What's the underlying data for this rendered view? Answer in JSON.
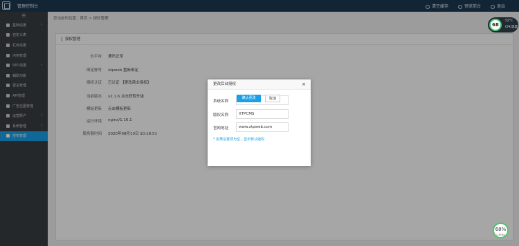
{
  "app": {
    "title": "管理控制台"
  },
  "topbar": {
    "links": [
      "清空缓存",
      "预览前台",
      "退出"
    ]
  },
  "sidebar": {
    "toggle": "☰",
    "items": [
      {
        "label": "基础设置",
        "arrow": true
      },
      {
        "label": "自定义表",
        "arrow": false
      },
      {
        "label": "栏目设置",
        "arrow": false
      },
      {
        "label": "内容管理",
        "arrow": false
      },
      {
        "label": "SEO设置",
        "arrow": true
      },
      {
        "label": "辅助功能",
        "arrow": false
      },
      {
        "label": "留言管理",
        "arrow": false
      },
      {
        "label": "API管理",
        "arrow": false
      },
      {
        "label": "广告位图管理",
        "arrow": false
      },
      {
        "label": "运营账户",
        "arrow": true
      },
      {
        "label": "系统管理",
        "arrow": true
      },
      {
        "label": "授权管理",
        "arrow": false,
        "active": true
      }
    ]
  },
  "breadcrumb": "您当前的位置：首页 > 授权管理",
  "panel": {
    "title": "授权管理",
    "rows": [
      {
        "label": "云平台",
        "value": "通讯正常",
        "link": true
      },
      {
        "label": "绑定账号",
        "value": "xtpweb 重新绑定",
        "link": false
      },
      {
        "label": "授权认证",
        "value": "已认证 【更改商业授权】",
        "link": true
      },
      {
        "label": "当前版本",
        "value": "v2.1.6  点击获取升级",
        "link": false
      },
      {
        "label": "模板更新",
        "value": "点击模板更新",
        "link": true
      },
      {
        "label": "运行环境",
        "value": "nginx/1.16.1",
        "link": false
      },
      {
        "label": "服务器时间",
        "value": "2020年08月10日 10:18:51",
        "link": false
      }
    ]
  },
  "dialog": {
    "title": "更改后台授权",
    "close": "×",
    "fields": [
      {
        "label": "系统名称",
        "value": "XTPCMS"
      },
      {
        "label": "版权名称",
        "value": "XTPCMS"
      },
      {
        "label": "官网地址",
        "value": "www.xtpweb.com"
      }
    ],
    "tip": "* 如果设置项为空，显示默认版权",
    "confirm": "确认更改",
    "cancel": "取消"
  },
  "widgets": {
    "cpu_percent": "68",
    "temp": "52°C",
    "cpu_label": "CPU温度",
    "net_percent": "68%",
    "net_rate": "1.5KB/s"
  }
}
